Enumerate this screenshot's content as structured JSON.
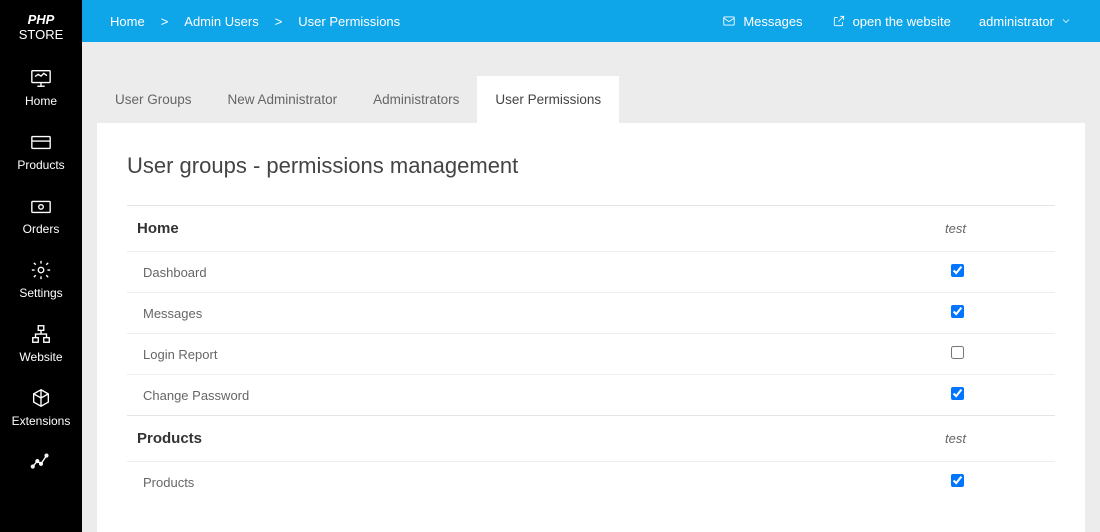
{
  "brand": {
    "line1": "PHP",
    "line2": "STORE"
  },
  "sidebar": [
    {
      "label": "Home",
      "icon": "monitor"
    },
    {
      "label": "Products",
      "icon": "card"
    },
    {
      "label": "Orders",
      "icon": "cash"
    },
    {
      "label": "Settings",
      "icon": "gear"
    },
    {
      "label": "Website",
      "icon": "sitemap"
    },
    {
      "label": "Extensions",
      "icon": "cube"
    },
    {
      "label": "",
      "icon": "stats"
    }
  ],
  "breadcrumb": [
    "Home",
    "Admin Users",
    "User Permissions"
  ],
  "topbar": {
    "messages": "Messages",
    "open_site": "open the website",
    "user": "administrator"
  },
  "tabs": [
    "User Groups",
    "New Administrator",
    "Administrators",
    "User Permissions"
  ],
  "active_tab": 3,
  "page_title": "User groups - permissions management",
  "col_label": "test",
  "sections": [
    {
      "title": "Home",
      "rows": [
        {
          "label": "Dashboard",
          "checked": true
        },
        {
          "label": "Messages",
          "checked": true
        },
        {
          "label": "Login Report",
          "checked": false
        },
        {
          "label": "Change Password",
          "checked": true
        }
      ]
    },
    {
      "title": "Products",
      "rows": [
        {
          "label": "Products",
          "checked": true
        }
      ]
    }
  ]
}
